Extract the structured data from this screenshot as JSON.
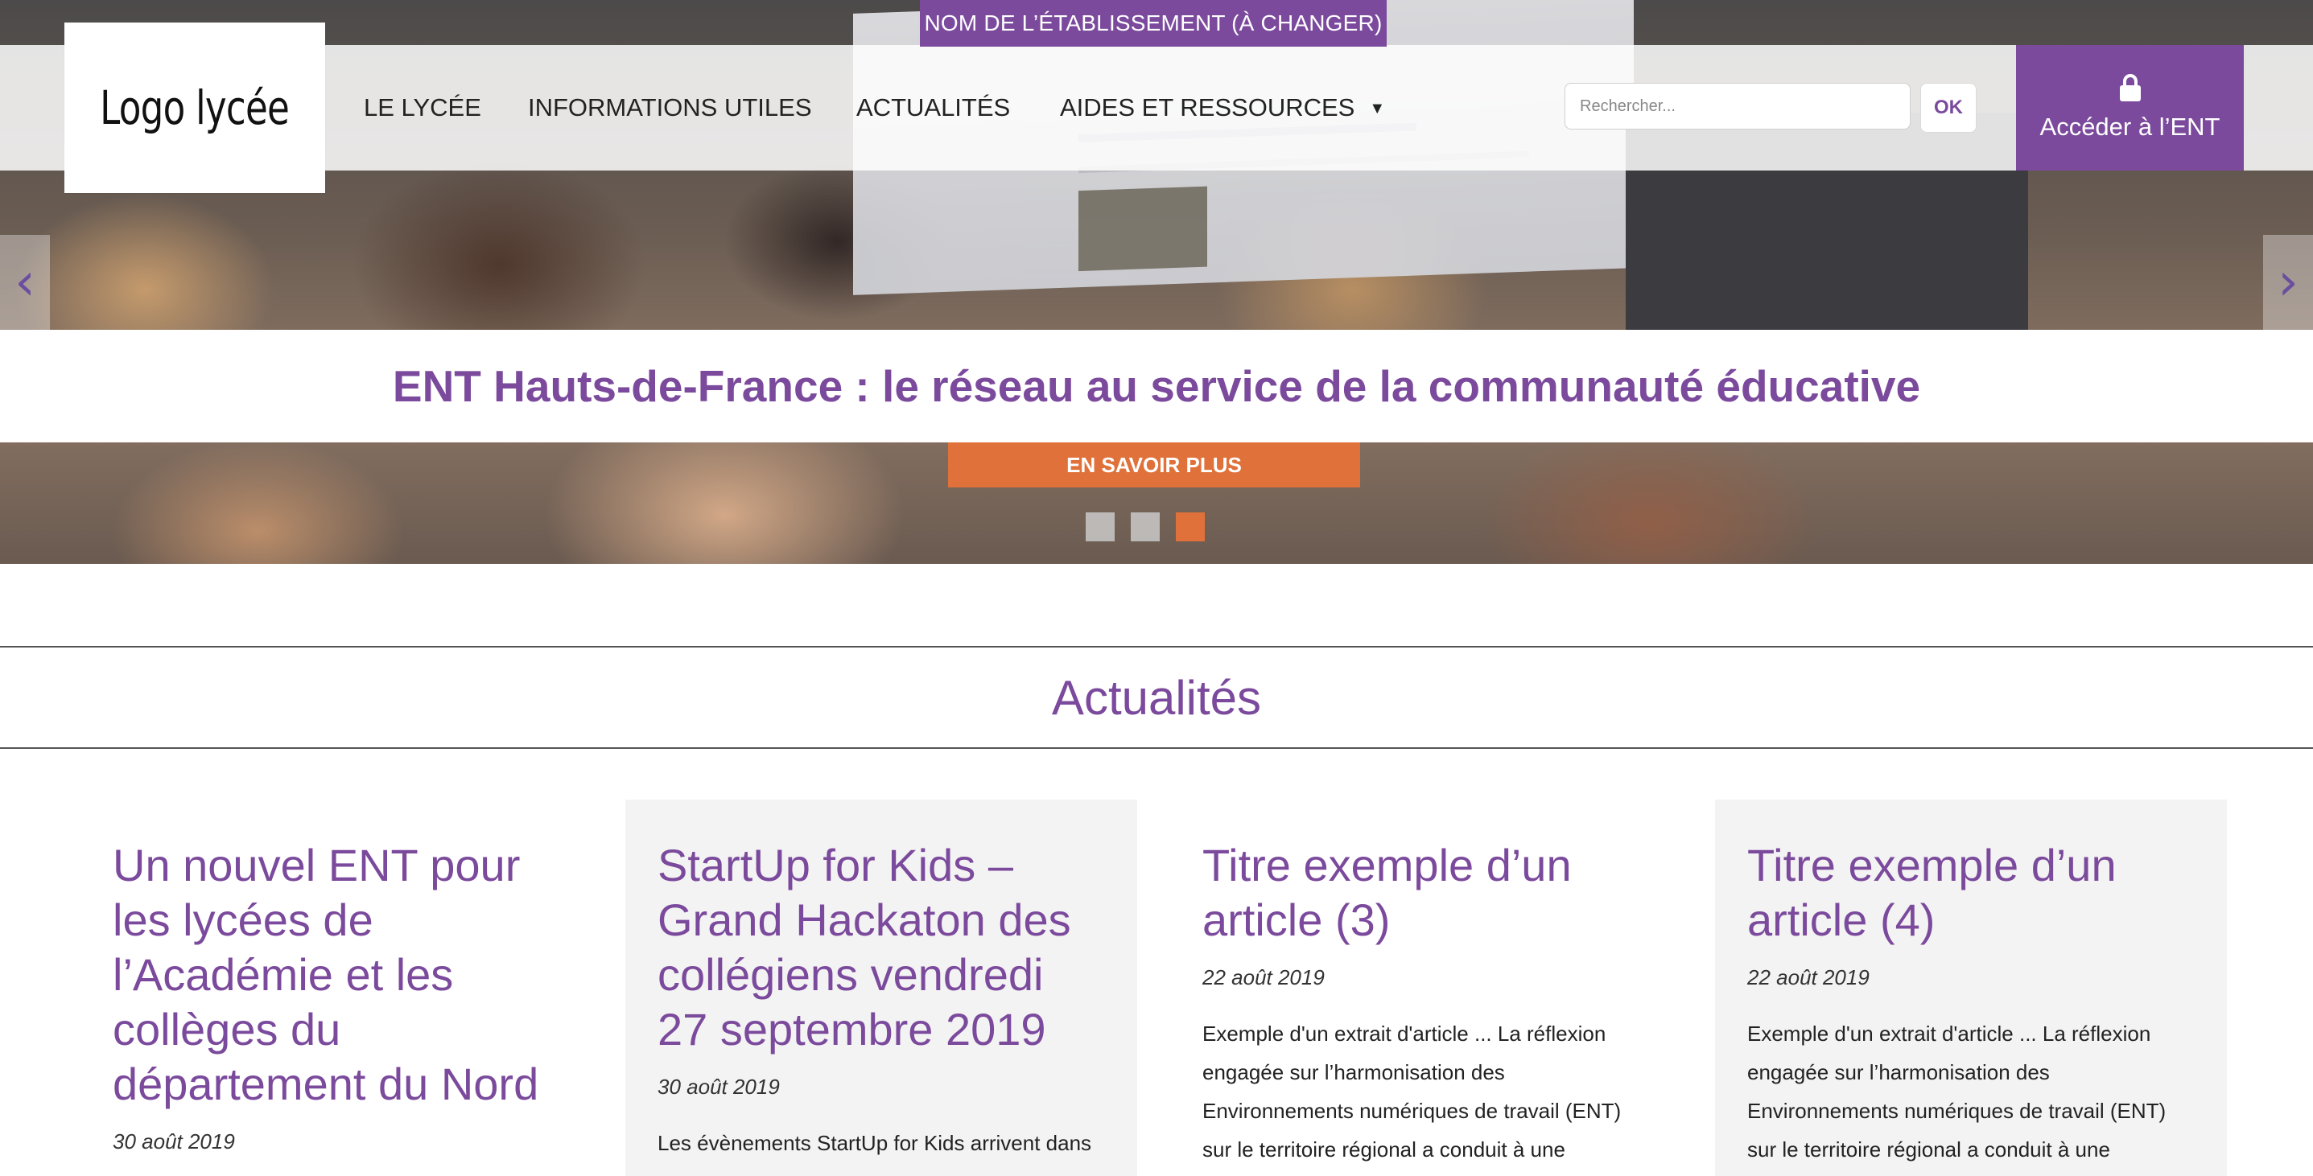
{
  "header": {
    "school_name_tab": "NOM DE L’ÉTABLISSEMENT (À CHANGER)",
    "logo_text": "Logo lycée",
    "nav": [
      {
        "label": "LE LYCÉE"
      },
      {
        "label": "INFORMATIONS UTILES"
      },
      {
        "label": "ACTUALITÉS"
      },
      {
        "label": "AIDES ET RESSOURCES",
        "has_dropdown": true
      }
    ],
    "search": {
      "placeholder": "Rechercher...",
      "value": ""
    },
    "ok_label": "OK",
    "ent_button_label": "Accéder à l’ENT",
    "ent_button_icon": "lock-icon"
  },
  "hero": {
    "caption": "ENT Hauts-de-France : le réseau au service de la communauté éducative",
    "cta_label": "EN SAVOIR PLUS",
    "slide_count": 3,
    "active_slide": 3,
    "prev_arrow": "‹",
    "next_arrow": "›"
  },
  "news": {
    "title": "Actualités",
    "articles": [
      {
        "title": "Un nouvel ENT pour les lycées de l’Académie et les collèges du département du Nord",
        "date": "30 août 2019",
        "excerpt": ""
      },
      {
        "title": "StartUp for Kids – Grand Hackaton des collégiens vendredi 27 septembre 2019",
        "date": "30 août 2019",
        "excerpt": "Les évènements StartUp for Kids arrivent dans"
      },
      {
        "title": "Titre exemple d’un article (3)",
        "date": "22 août 2019",
        "excerpt": "Exemple d'un extrait d'article ... La réflexion engagée sur l’harmonisation des Environnements numériques de travail (ENT) sur le territoire régional a conduit à une stratégie de"
      },
      {
        "title": "Titre exemple d’un article (4)",
        "date": "22 août 2019",
        "excerpt": "Exemple d'un extrait d'article ... La réflexion engagée sur l’harmonisation des Environnements numériques de travail (ENT) sur le territoire régional a conduit à une stratégie de"
      }
    ]
  },
  "colors": {
    "brand_purple": "#7b4a9c",
    "accent_orange": "#e0713a",
    "card_shade": "#f3f3f3"
  }
}
